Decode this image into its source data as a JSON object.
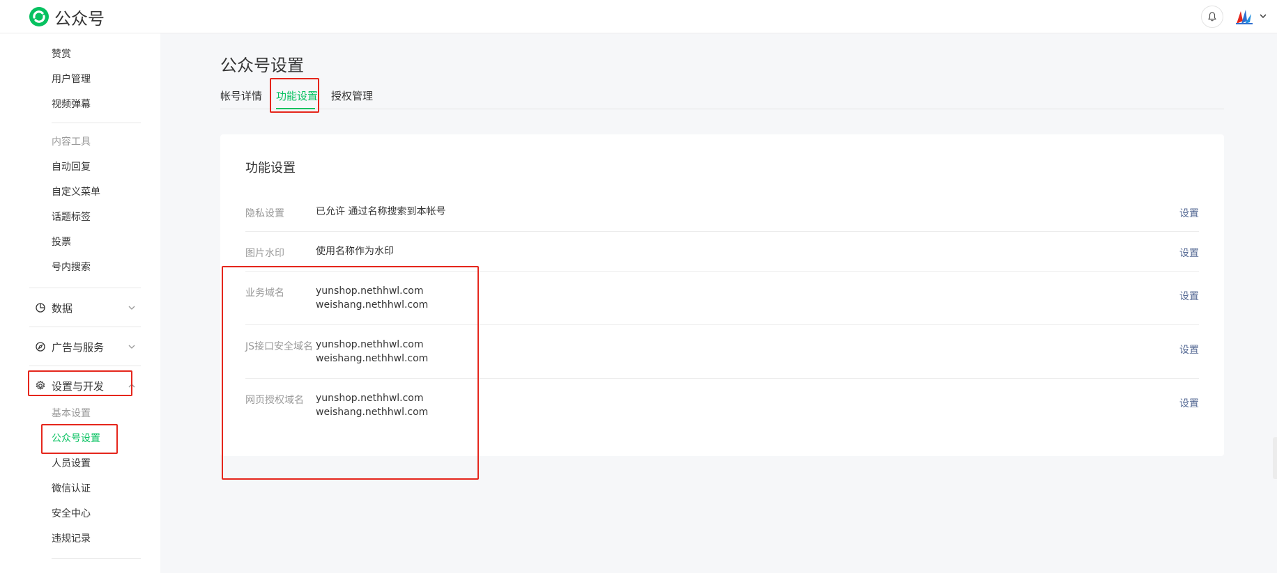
{
  "header": {
    "brand_name": "公众号",
    "brand_color": "#07c160"
  },
  "sidebar": {
    "top_items": [
      {
        "label": "赞赏"
      },
      {
        "label": "用户管理"
      },
      {
        "label": "视频弹幕"
      }
    ],
    "content_tools": {
      "heading": "内容工具",
      "items": [
        {
          "label": "自动回复"
        },
        {
          "label": "自定义菜单"
        },
        {
          "label": "话题标签"
        },
        {
          "label": "投票"
        },
        {
          "label": "号内搜索"
        }
      ]
    },
    "groups": [
      {
        "label": "数据",
        "icon": "pie-chart-icon",
        "expanded": false
      },
      {
        "label": "广告与服务",
        "icon": "compass-icon",
        "expanded": false
      },
      {
        "label": "设置与开发",
        "icon": "gear-icon",
        "expanded": true
      }
    ],
    "settings_sub": {
      "heading": "基本设置",
      "items": [
        {
          "label": "公众号设置",
          "active": true
        },
        {
          "label": "人员设置"
        },
        {
          "label": "微信认证"
        },
        {
          "label": "安全中心"
        },
        {
          "label": "违规记录"
        }
      ]
    }
  },
  "main": {
    "page_title": "公众号设置",
    "tabs": [
      {
        "label": "帐号详情",
        "active": false
      },
      {
        "label": "功能设置",
        "active": true
      },
      {
        "label": "授权管理",
        "active": false
      }
    ],
    "card": {
      "title": "功能设置",
      "rows": [
        {
          "label": "隐私设置",
          "values": [
            "已允许 通过名称搜索到本帐号"
          ],
          "action": "设置"
        },
        {
          "label": "图片水印",
          "values": [
            "使用名称作为水印"
          ],
          "action": "设置"
        },
        {
          "label": "业务域名",
          "values": [
            "yunshop.nethhwl.com",
            "weishang.nethhwl.com"
          ],
          "action": "设置"
        },
        {
          "label": "JS接口安全域名",
          "values": [
            "yunshop.nethhwl.com",
            "weishang.nethhwl.com"
          ],
          "action": "设置"
        },
        {
          "label": "网页授权域名",
          "values": [
            "yunshop.nethhwl.com",
            "weishang.nethhwl.com"
          ],
          "action": "设置"
        }
      ]
    }
  },
  "colors": {
    "accent": "#07c160",
    "link": "#576b95",
    "annotation": "#e5261c"
  }
}
